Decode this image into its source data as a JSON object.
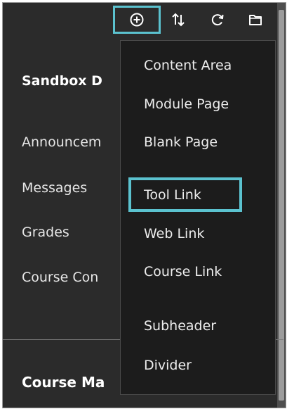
{
  "toolbar": {
    "icons": [
      "add-circle-icon",
      "sort-icon",
      "refresh-icon",
      "folder-icon"
    ],
    "highlight_color": "#5bc2cf"
  },
  "course_menu": {
    "title": "Sandbox D",
    "items": [
      "Announcem",
      "Messages",
      "Grades",
      "Course Con"
    ],
    "section_title": "Course Ma"
  },
  "dropdown": {
    "items": [
      "Content Area",
      "Module Page",
      "Blank Page",
      "Tool Link",
      "Web Link",
      "Course Link",
      "Subheader",
      "Divider"
    ],
    "highlighted_item": "Tool Link"
  },
  "colors": {
    "background": "#2b2b2b",
    "dropdown_background": "#1c1c1c",
    "accent": "#5bc2cf"
  }
}
